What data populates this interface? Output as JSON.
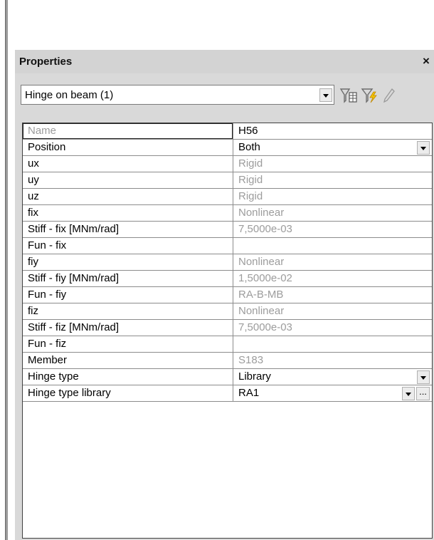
{
  "panel": {
    "title": "Properties",
    "close_symbol": "×"
  },
  "selector": {
    "value": "Hinge on beam (1)"
  },
  "toolbar": {
    "icons": [
      "filter-table-icon",
      "filter-lightning-icon",
      "pencil-icon"
    ]
  },
  "properties": [
    {
      "name": "Name",
      "value": "H56"
    },
    {
      "name": "Position",
      "value": "Both"
    },
    {
      "name": "ux",
      "value": "Rigid"
    },
    {
      "name": "uy",
      "value": "Rigid"
    },
    {
      "name": "uz",
      "value": "Rigid"
    },
    {
      "name": "fix",
      "value": "Nonlinear"
    },
    {
      "name": "Stiff - fix [MNm/rad]",
      "value": "7,5000e-03"
    },
    {
      "name": "Fun - fix",
      "value": ""
    },
    {
      "name": "fiy",
      "value": "Nonlinear"
    },
    {
      "name": "Stiff - fiy [MNm/rad]",
      "value": "1,5000e-02"
    },
    {
      "name": "Fun - fiy",
      "value": "RA-B-MB"
    },
    {
      "name": "fiz",
      "value": "Nonlinear"
    },
    {
      "name": "Stiff - fiz [MNm/rad]",
      "value": "7,5000e-03"
    },
    {
      "name": "Fun - fiz",
      "value": ""
    },
    {
      "name": "Member",
      "value": "S183"
    },
    {
      "name": "Hinge type",
      "value": "Library"
    },
    {
      "name": "Hinge type library",
      "value": "RA1"
    }
  ],
  "ellipsis_label": "...",
  "colors": {
    "panel_bg": "#d9d9d9",
    "disabled_text": "#9c9c9c"
  }
}
